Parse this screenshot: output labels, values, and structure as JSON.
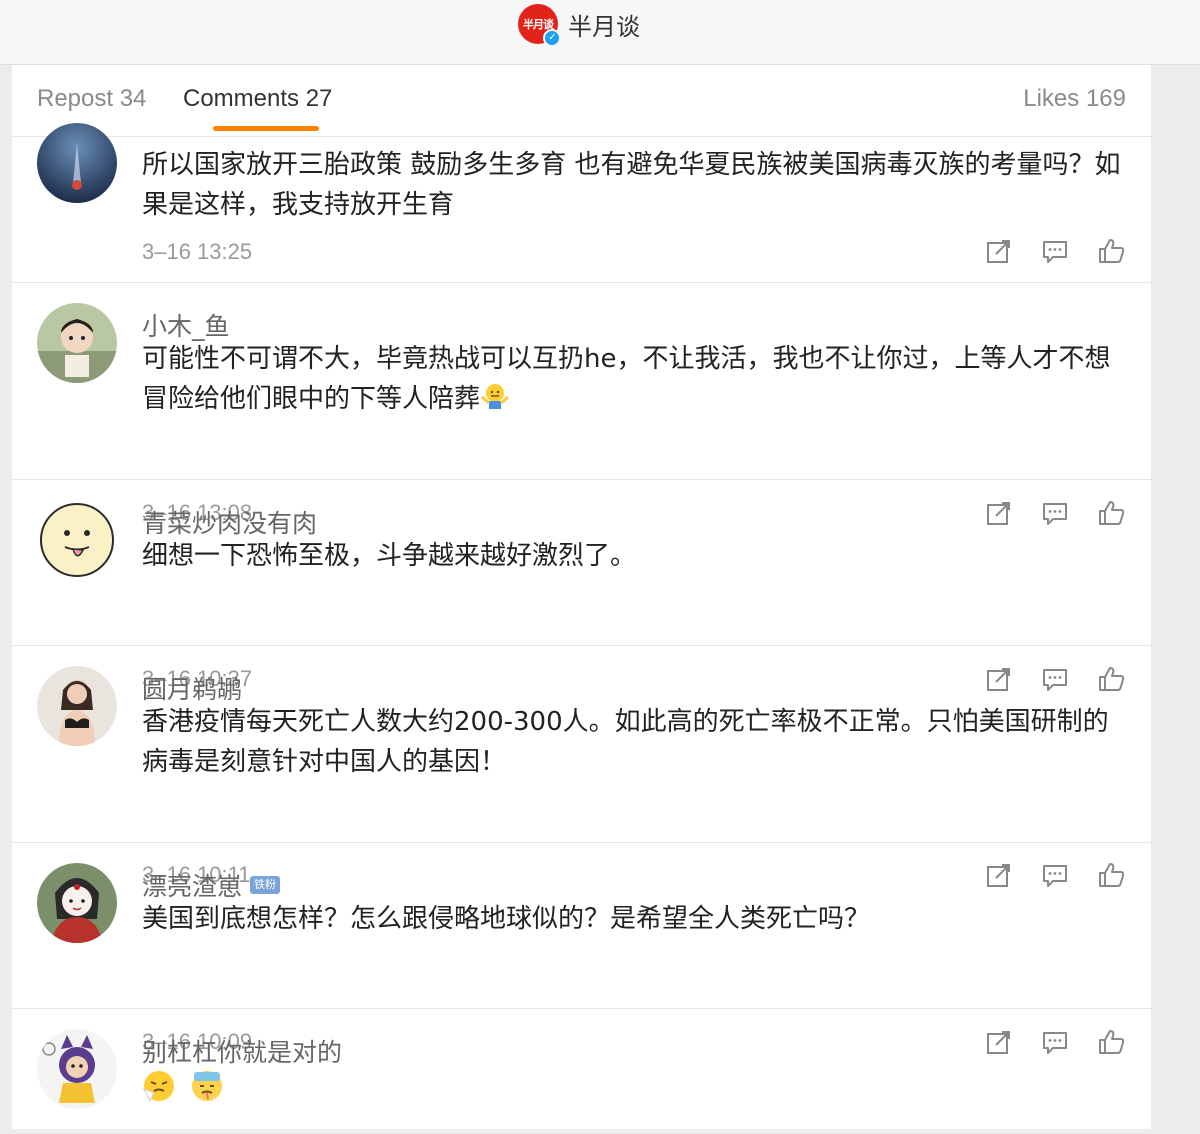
{
  "header": {
    "account_name": "半月谈",
    "logo_text": "半月谈"
  },
  "tabs": {
    "repost": "Repost 34",
    "comments": "Comments 27",
    "likes": "Likes 169"
  },
  "comments": [
    {
      "user": "",
      "text": "所以国家放开三胎政策 鼓励多生多育 也有避免华夏民族被美国病毒灭族的考量吗？如果是这样，我支持放开生育",
      "time": "3–16 13:25"
    },
    {
      "user": "小木_鱼",
      "text": "可能性不可谓不大，毕竟热战可以互扔he，不让我活，我也不让你过，上等人才不想冒险给他们眼中的下等人陪葬",
      "emoji": "shrug-emoji",
      "time": "3–16 13:08"
    },
    {
      "user": "青菜炒肉没有肉",
      "text": "细想一下恐怖至极，斗争越来越好激烈了。",
      "time": "3–16 10:37"
    },
    {
      "user": "圆月鹈鹕",
      "text": "香港疫情每天死亡人数大约200-300人。如此高的死亡率极不正常。只怕美国研制的病毒是刻意针对中国人的基因！",
      "time": "3–16 10:11"
    },
    {
      "user": "漂亮渣崽",
      "badge": "铁粉",
      "text": "美国到底想怎样？怎么跟侵略地球似的？是希望全人类死亡吗？",
      "time": "3–16 10:09"
    },
    {
      "user": "别杠杠你就是对的",
      "emojis": [
        "sneeze-emoji",
        "sick-emoji"
      ]
    }
  ],
  "icons": {
    "actions": [
      "share-icon",
      "comment-icon",
      "like-icon"
    ]
  },
  "colors": {
    "accent": "#ff8200",
    "brand": "#e2231a",
    "badge": "#7aa4d8"
  }
}
